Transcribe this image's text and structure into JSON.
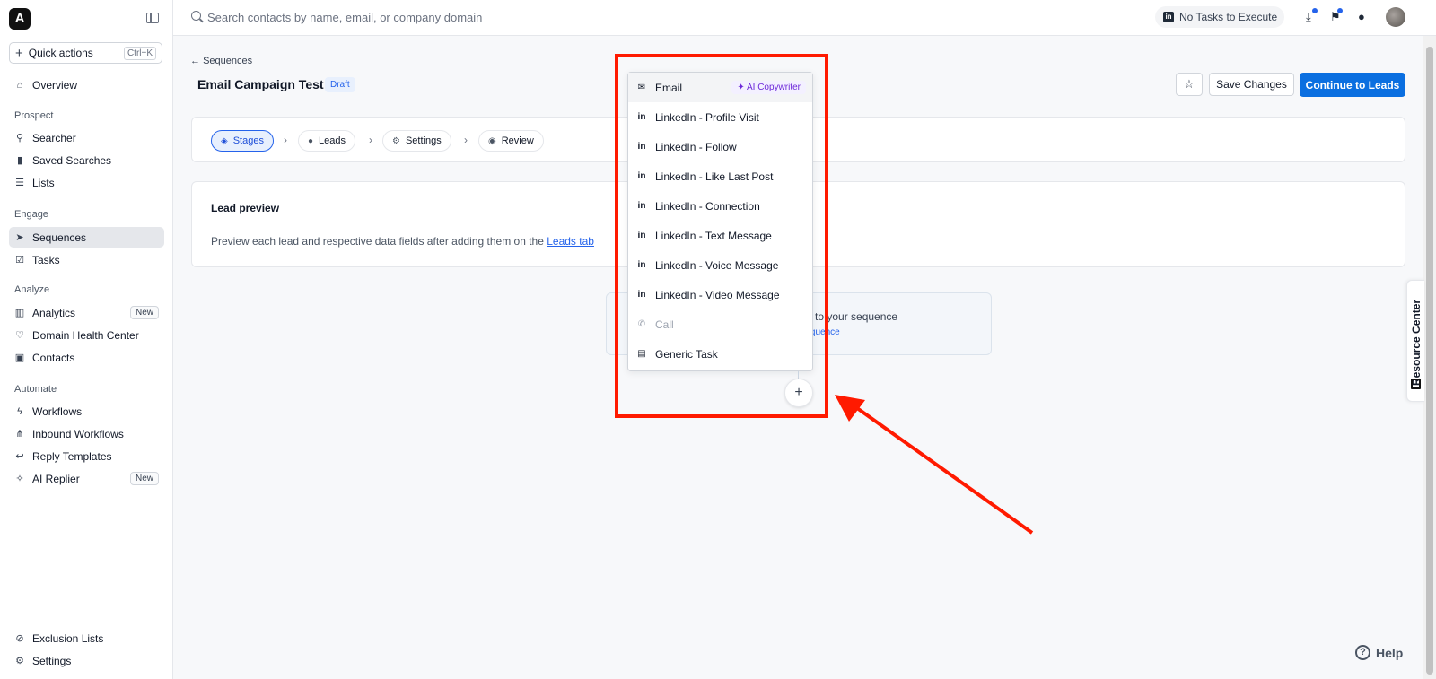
{
  "sidebar": {
    "logo": "A",
    "quick_actions": {
      "label": "Quick actions",
      "shortcut": "Ctrl+K"
    },
    "items": [
      {
        "label": "Overview"
      },
      {
        "label": "Searcher"
      },
      {
        "label": "Saved Searches"
      },
      {
        "label": "Lists"
      },
      {
        "label": "Sequences"
      },
      {
        "label": "Tasks"
      },
      {
        "label": "Analytics",
        "badge": "New"
      },
      {
        "label": "Domain Health Center"
      },
      {
        "label": "Contacts"
      },
      {
        "label": "Workflows"
      },
      {
        "label": "Inbound Workflows"
      },
      {
        "label": "Reply Templates"
      },
      {
        "label": "AI Replier",
        "badge": "New"
      },
      {
        "label": "Exclusion Lists"
      },
      {
        "label": "Settings"
      }
    ],
    "sections": [
      "Prospect",
      "Engage",
      "Analyze",
      "Automate"
    ]
  },
  "topbar": {
    "search_placeholder": "Search contacts by name, email, or company domain",
    "tasks_label": "No Tasks to Execute",
    "linkedin_icon": "in"
  },
  "header": {
    "back_label": "Sequences",
    "title": "Email Campaign Test",
    "status": "Draft",
    "save_label": "Save Changes",
    "continue_label": "Continue to Leads"
  },
  "stepper": {
    "steps": [
      {
        "label": "Stages"
      },
      {
        "label": "Leads"
      },
      {
        "label": "Settings"
      },
      {
        "label": "Review"
      }
    ]
  },
  "lead_preview": {
    "title": "Lead preview",
    "description": "Preview each lead and respective data fields after adding them on the ",
    "link": "Leads tab"
  },
  "stage_hint": {
    "text": "to your sequence",
    "link": "g sequence"
  },
  "dropdown": {
    "items": [
      {
        "label": "Email",
        "badge": "AI Copywriter",
        "icon": "envelope-icon"
      },
      {
        "label": "LinkedIn - Profile Visit",
        "icon": "in"
      },
      {
        "label": "LinkedIn - Follow",
        "icon": "in"
      },
      {
        "label": "LinkedIn - Like Last Post",
        "icon": "in"
      },
      {
        "label": "LinkedIn - Connection",
        "icon": "in"
      },
      {
        "label": "LinkedIn - Text Message",
        "icon": "in"
      },
      {
        "label": "LinkedIn - Voice Message",
        "icon": "in"
      },
      {
        "label": "LinkedIn - Video Message",
        "icon": "in"
      },
      {
        "label": "Call",
        "icon": "phone-icon",
        "disabled": true
      },
      {
        "label": "Generic Task",
        "icon": "task-icon"
      }
    ]
  },
  "resource_center": {
    "label": "Resource Center"
  },
  "help": {
    "label": "Help",
    "icon": "?"
  },
  "colors": {
    "accent": "#0b6fe0",
    "annotation": "#ff1a00",
    "ai_badge": "#6d28d9"
  }
}
